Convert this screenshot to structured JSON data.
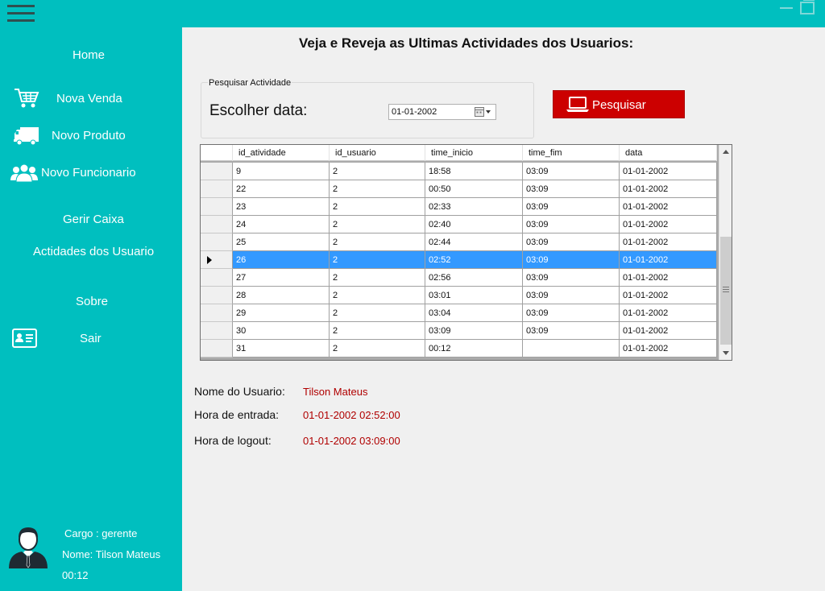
{
  "sidebar": {
    "items": [
      {
        "label": "Home",
        "icon": "none"
      },
      {
        "label": "Nova Venda",
        "icon": "shopping-cart-icon"
      },
      {
        "label": "Novo Produto",
        "icon": "truck-icon"
      },
      {
        "label": "Novo Funcionario",
        "icon": "users-icon"
      },
      {
        "label": "Gerir Caixa",
        "icon": "none"
      },
      {
        "label": "Actidades dos Usuario",
        "icon": "none"
      },
      {
        "label": "Sobre",
        "icon": "none"
      },
      {
        "label": "Sair",
        "icon": "id-card-icon"
      }
    ],
    "user": {
      "cargo": "Cargo : gerente",
      "nome": "Nome: Tilson Mateus",
      "time": "00:12"
    }
  },
  "main": {
    "title": "Veja e Reveja as Ultimas Actividades dos Usuarios:",
    "search_group": {
      "legend": "Pesquisar Actividade",
      "label": "Escolher data:",
      "date_value": "01-01-2002"
    },
    "search_button": "Pesquisar",
    "grid": {
      "columns": [
        "id_atividade",
        "id_usuario",
        "time_inicio",
        "time_fim",
        "data"
      ],
      "rows": [
        [
          "9",
          "2",
          "18:58",
          "03:09",
          "01-01-2002"
        ],
        [
          "22",
          "2",
          "00:50",
          "03:09",
          "01-01-2002"
        ],
        [
          "23",
          "2",
          "02:33",
          "03:09",
          "01-01-2002"
        ],
        [
          "24",
          "2",
          "02:40",
          "03:09",
          "01-01-2002"
        ],
        [
          "25",
          "2",
          "02:44",
          "03:09",
          "01-01-2002"
        ],
        [
          "26",
          "2",
          "02:52",
          "03:09",
          "01-01-2002"
        ],
        [
          "27",
          "2",
          "02:56",
          "03:09",
          "01-01-2002"
        ],
        [
          "28",
          "2",
          "03:01",
          "03:09",
          "01-01-2002"
        ],
        [
          "29",
          "2",
          "03:04",
          "03:09",
          "01-01-2002"
        ],
        [
          "30",
          "2",
          "03:09",
          "03:09",
          "01-01-2002"
        ],
        [
          "31",
          "2",
          "00:12",
          "",
          "01-01-2002"
        ]
      ],
      "selected_row": 5
    },
    "details": {
      "user_label": "Nome do Usuario:",
      "user_value": "Tilson Mateus",
      "entry_label": "Hora de entrada:",
      "entry_value": "01-01-2002 02:52:00",
      "logout_label": "Hora de logout:",
      "logout_value": "01-01-2002 03:09:00"
    }
  },
  "colors": {
    "sidebar": "#00bfbf",
    "accent_button": "#cc0000",
    "selection": "#3399ff",
    "detail_value": "#b00000"
  }
}
